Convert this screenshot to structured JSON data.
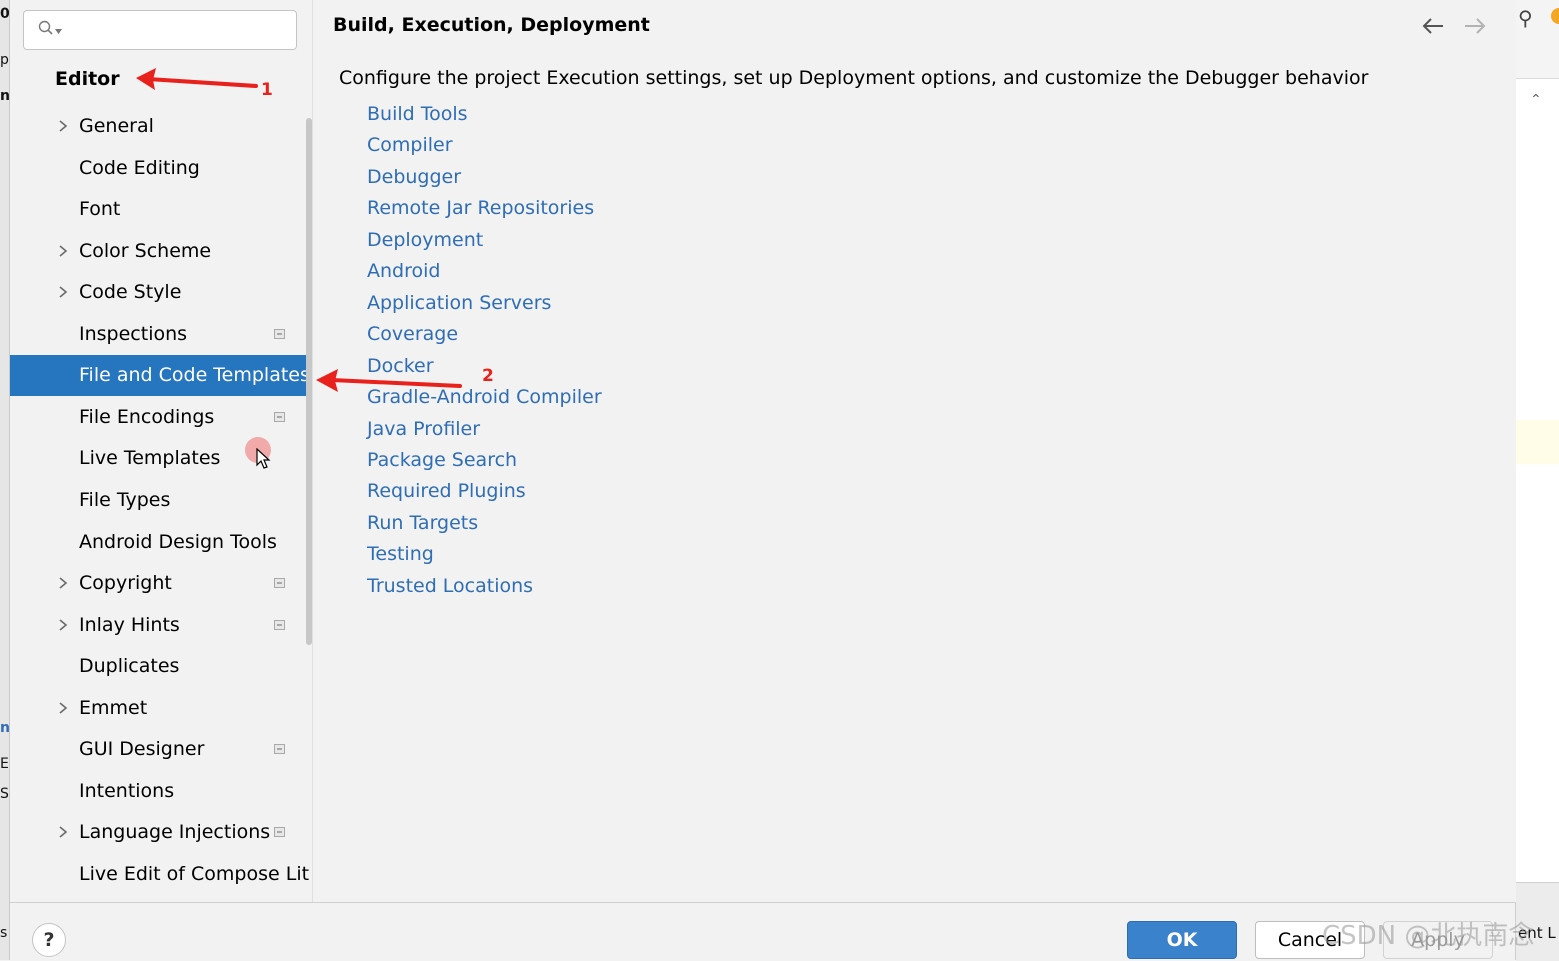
{
  "sidebar": {
    "search_placeholder": "",
    "section_title": "Editor",
    "items": [
      {
        "label": "General",
        "expandable": true,
        "project_icon": false
      },
      {
        "label": "Code Editing",
        "expandable": false,
        "project_icon": false
      },
      {
        "label": "Font",
        "expandable": false,
        "project_icon": false
      },
      {
        "label": "Color Scheme",
        "expandable": true,
        "project_icon": false
      },
      {
        "label": "Code Style",
        "expandable": true,
        "project_icon": false
      },
      {
        "label": "Inspections",
        "expandable": false,
        "project_icon": true
      },
      {
        "label": "File and Code Templates",
        "expandable": false,
        "project_icon": false,
        "selected": true
      },
      {
        "label": "File Encodings",
        "expandable": false,
        "project_icon": true
      },
      {
        "label": "Live Templates",
        "expandable": false,
        "project_icon": false
      },
      {
        "label": "File Types",
        "expandable": false,
        "project_icon": false
      },
      {
        "label": "Android Design Tools",
        "expandable": false,
        "project_icon": false
      },
      {
        "label": "Copyright",
        "expandable": true,
        "project_icon": true
      },
      {
        "label": "Inlay Hints",
        "expandable": true,
        "project_icon": true
      },
      {
        "label": "Duplicates",
        "expandable": false,
        "project_icon": false
      },
      {
        "label": "Emmet",
        "expandable": true,
        "project_icon": false
      },
      {
        "label": "GUI Designer",
        "expandable": false,
        "project_icon": true
      },
      {
        "label": "Intentions",
        "expandable": false,
        "project_icon": false
      },
      {
        "label": "Language Injections",
        "expandable": true,
        "project_icon": true
      },
      {
        "label": "Live Edit of Compose Lit",
        "expandable": false,
        "project_icon": false
      }
    ]
  },
  "main": {
    "breadcrumb": "Build, Execution, Deployment",
    "description": "Configure the project Execution settings, set up Deployment options, and customize the Debugger behavior",
    "links": [
      "Build Tools",
      "Compiler",
      "Debugger",
      "Remote Jar Repositories",
      "Deployment",
      "Android",
      "Application Servers",
      "Coverage",
      "Docker",
      "Gradle-Android Compiler",
      "Java Profiler",
      "Package Search",
      "Required Plugins",
      "Run Targets",
      "Testing",
      "Trusted Locations"
    ]
  },
  "footer": {
    "help_label": "?",
    "ok_label": "OK",
    "cancel_label": "Cancel",
    "apply_label": "Apply"
  },
  "annotations": {
    "arrow1_label": "1",
    "arrow2_label": "2",
    "color": "#e8211c"
  },
  "watermark": "CSDN @北执南念",
  "background_app": {
    "right_edge_label": "ent L"
  },
  "colors": {
    "selection": "#2675bf",
    "link": "#2f6db5",
    "ok_button": "#3b82cc"
  }
}
